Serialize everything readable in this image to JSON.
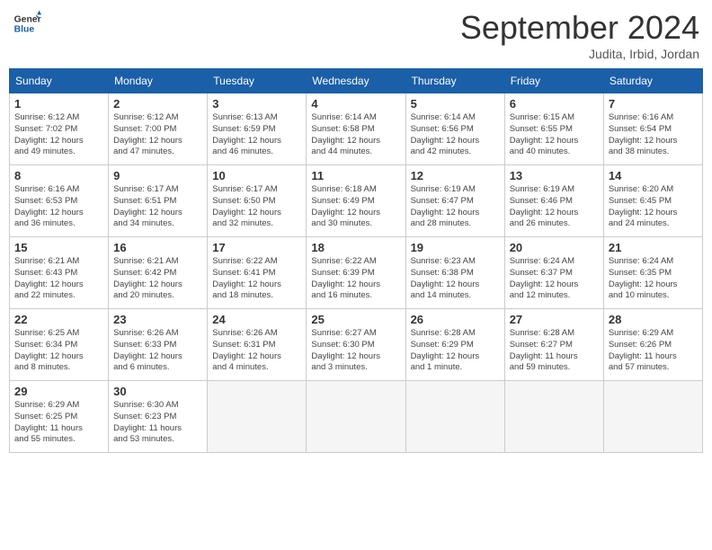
{
  "header": {
    "logo_line1": "General",
    "logo_line2": "Blue",
    "month_title": "September 2024",
    "location": "Judita, Irbid, Jordan"
  },
  "weekdays": [
    "Sunday",
    "Monday",
    "Tuesday",
    "Wednesday",
    "Thursday",
    "Friday",
    "Saturday"
  ],
  "weeks": [
    [
      {
        "day": "1",
        "info": "Sunrise: 6:12 AM\nSunset: 7:02 PM\nDaylight: 12 hours\nand 49 minutes."
      },
      {
        "day": "2",
        "info": "Sunrise: 6:12 AM\nSunset: 7:00 PM\nDaylight: 12 hours\nand 47 minutes."
      },
      {
        "day": "3",
        "info": "Sunrise: 6:13 AM\nSunset: 6:59 PM\nDaylight: 12 hours\nand 46 minutes."
      },
      {
        "day": "4",
        "info": "Sunrise: 6:14 AM\nSunset: 6:58 PM\nDaylight: 12 hours\nand 44 minutes."
      },
      {
        "day": "5",
        "info": "Sunrise: 6:14 AM\nSunset: 6:56 PM\nDaylight: 12 hours\nand 42 minutes."
      },
      {
        "day": "6",
        "info": "Sunrise: 6:15 AM\nSunset: 6:55 PM\nDaylight: 12 hours\nand 40 minutes."
      },
      {
        "day": "7",
        "info": "Sunrise: 6:16 AM\nSunset: 6:54 PM\nDaylight: 12 hours\nand 38 minutes."
      }
    ],
    [
      {
        "day": "8",
        "info": "Sunrise: 6:16 AM\nSunset: 6:53 PM\nDaylight: 12 hours\nand 36 minutes."
      },
      {
        "day": "9",
        "info": "Sunrise: 6:17 AM\nSunset: 6:51 PM\nDaylight: 12 hours\nand 34 minutes."
      },
      {
        "day": "10",
        "info": "Sunrise: 6:17 AM\nSunset: 6:50 PM\nDaylight: 12 hours\nand 32 minutes."
      },
      {
        "day": "11",
        "info": "Sunrise: 6:18 AM\nSunset: 6:49 PM\nDaylight: 12 hours\nand 30 minutes."
      },
      {
        "day": "12",
        "info": "Sunrise: 6:19 AM\nSunset: 6:47 PM\nDaylight: 12 hours\nand 28 minutes."
      },
      {
        "day": "13",
        "info": "Sunrise: 6:19 AM\nSunset: 6:46 PM\nDaylight: 12 hours\nand 26 minutes."
      },
      {
        "day": "14",
        "info": "Sunrise: 6:20 AM\nSunset: 6:45 PM\nDaylight: 12 hours\nand 24 minutes."
      }
    ],
    [
      {
        "day": "15",
        "info": "Sunrise: 6:21 AM\nSunset: 6:43 PM\nDaylight: 12 hours\nand 22 minutes."
      },
      {
        "day": "16",
        "info": "Sunrise: 6:21 AM\nSunset: 6:42 PM\nDaylight: 12 hours\nand 20 minutes."
      },
      {
        "day": "17",
        "info": "Sunrise: 6:22 AM\nSunset: 6:41 PM\nDaylight: 12 hours\nand 18 minutes."
      },
      {
        "day": "18",
        "info": "Sunrise: 6:22 AM\nSunset: 6:39 PM\nDaylight: 12 hours\nand 16 minutes."
      },
      {
        "day": "19",
        "info": "Sunrise: 6:23 AM\nSunset: 6:38 PM\nDaylight: 12 hours\nand 14 minutes."
      },
      {
        "day": "20",
        "info": "Sunrise: 6:24 AM\nSunset: 6:37 PM\nDaylight: 12 hours\nand 12 minutes."
      },
      {
        "day": "21",
        "info": "Sunrise: 6:24 AM\nSunset: 6:35 PM\nDaylight: 12 hours\nand 10 minutes."
      }
    ],
    [
      {
        "day": "22",
        "info": "Sunrise: 6:25 AM\nSunset: 6:34 PM\nDaylight: 12 hours\nand 8 minutes."
      },
      {
        "day": "23",
        "info": "Sunrise: 6:26 AM\nSunset: 6:33 PM\nDaylight: 12 hours\nand 6 minutes."
      },
      {
        "day": "24",
        "info": "Sunrise: 6:26 AM\nSunset: 6:31 PM\nDaylight: 12 hours\nand 4 minutes."
      },
      {
        "day": "25",
        "info": "Sunrise: 6:27 AM\nSunset: 6:30 PM\nDaylight: 12 hours\nand 3 minutes."
      },
      {
        "day": "26",
        "info": "Sunrise: 6:28 AM\nSunset: 6:29 PM\nDaylight: 12 hours\nand 1 minute."
      },
      {
        "day": "27",
        "info": "Sunrise: 6:28 AM\nSunset: 6:27 PM\nDaylight: 11 hours\nand 59 minutes."
      },
      {
        "day": "28",
        "info": "Sunrise: 6:29 AM\nSunset: 6:26 PM\nDaylight: 11 hours\nand 57 minutes."
      }
    ],
    [
      {
        "day": "29",
        "info": "Sunrise: 6:29 AM\nSunset: 6:25 PM\nDaylight: 11 hours\nand 55 minutes."
      },
      {
        "day": "30",
        "info": "Sunrise: 6:30 AM\nSunset: 6:23 PM\nDaylight: 11 hours\nand 53 minutes."
      },
      {
        "day": "",
        "info": ""
      },
      {
        "day": "",
        "info": ""
      },
      {
        "day": "",
        "info": ""
      },
      {
        "day": "",
        "info": ""
      },
      {
        "day": "",
        "info": ""
      }
    ]
  ]
}
